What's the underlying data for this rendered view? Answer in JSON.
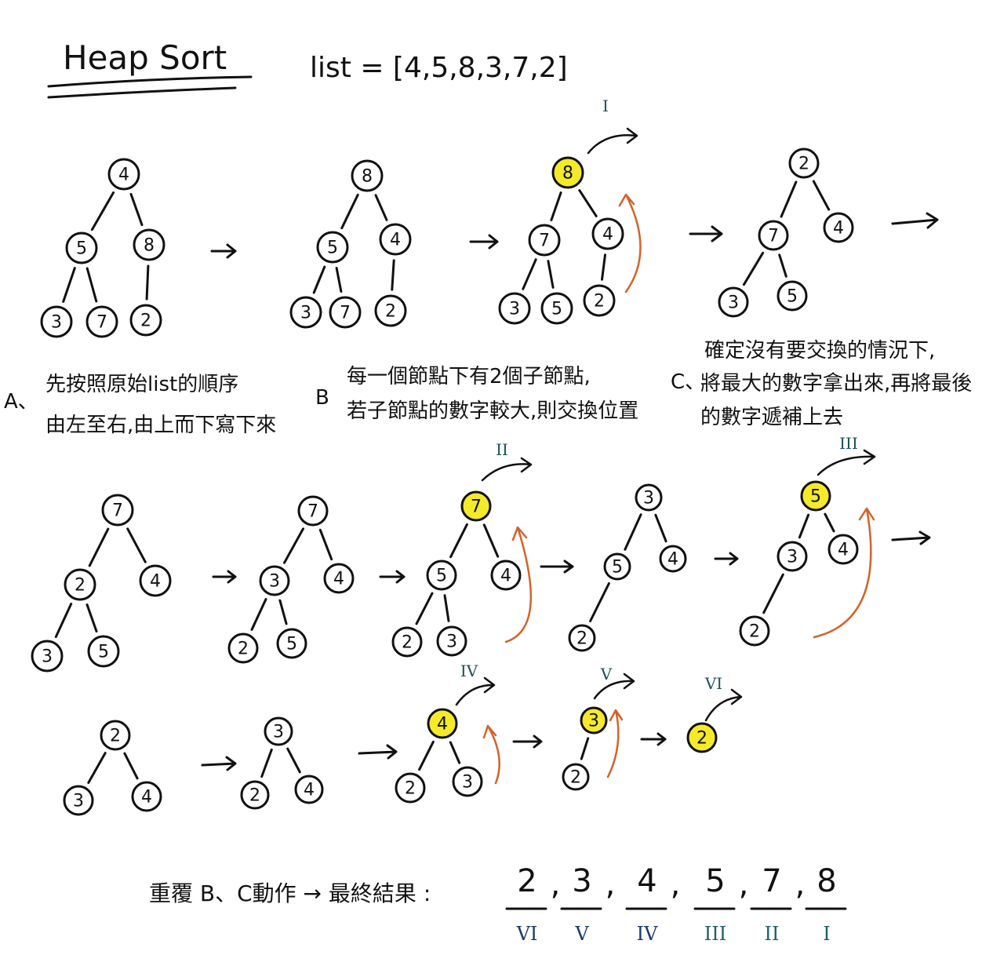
{
  "title": "Heap Sort",
  "list_label": "list = [4,5,8,3,7,2]",
  "steps": {
    "a": {
      "marker": "A、",
      "line1": "先按照原始list的順序",
      "line2": "由左至右,由上而下寫下來"
    },
    "b": {
      "marker": "B",
      "line1": "每一個節點下有2個子節點,",
      "line2": "若子節點的數字較大,則交換位置"
    },
    "c": {
      "marker": "C、",
      "line1": "確定沒有要交換的情況下,",
      "line2": "將最大的數字拿出來,再將最後",
      "line3": "的數字遞補上去"
    }
  },
  "trees": [
    {
      "nodes": [
        "4",
        "5",
        "8",
        "3",
        "7",
        "2"
      ],
      "highlight": null
    },
    {
      "nodes": [
        "8",
        "5",
        "4",
        "3",
        "7",
        "2"
      ],
      "highlight": null
    },
    {
      "nodes": [
        "8",
        "7",
        "4",
        "3",
        "5",
        "2"
      ],
      "highlight": 0,
      "extract_label": "I"
    },
    {
      "nodes": [
        "2",
        "7",
        "4",
        "3",
        "5"
      ],
      "highlight": null
    },
    {
      "nodes": [
        "7",
        "2",
        "4",
        "3",
        "5"
      ],
      "highlight": null
    },
    {
      "nodes": [
        "7",
        "3",
        "4",
        "2",
        "5"
      ],
      "highlight": null
    },
    {
      "nodes": [
        "7",
        "5",
        "4",
        "2",
        "3"
      ],
      "highlight": 0,
      "extract_label": "II"
    },
    {
      "nodes": [
        "3",
        "5",
        "4",
        "2"
      ],
      "highlight": null
    },
    {
      "nodes": [
        "5",
        "3",
        "4",
        "2"
      ],
      "highlight": 0,
      "extract_label": "III"
    },
    {
      "nodes": [
        "2",
        "3",
        "4"
      ],
      "highlight": null
    },
    {
      "nodes": [
        "3",
        "2",
        "4"
      ],
      "highlight": null
    },
    {
      "nodes": [
        "4",
        "2",
        "3"
      ],
      "highlight": 0,
      "extract_label": "IV"
    },
    {
      "nodes": [
        "3",
        "2"
      ],
      "highlight": 0,
      "extract_label": "V"
    },
    {
      "nodes": [
        "2"
      ],
      "highlight": 0,
      "extract_label": "VI"
    }
  ],
  "result": {
    "label": "重覆 B、C動作 → 最終結果 :",
    "items": [
      {
        "value": "2",
        "label": "VI"
      },
      {
        "value": "3",
        "label": "V"
      },
      {
        "value": "4",
        "label": "IV"
      },
      {
        "value": "5",
        "label": "III"
      },
      {
        "value": "7",
        "label": "II"
      },
      {
        "value": "8",
        "label": "I"
      }
    ]
  },
  "colors": {
    "highlight": "#f4ea2a",
    "swap_arrow": "#d4622a",
    "roman": "#1f4f5a"
  }
}
